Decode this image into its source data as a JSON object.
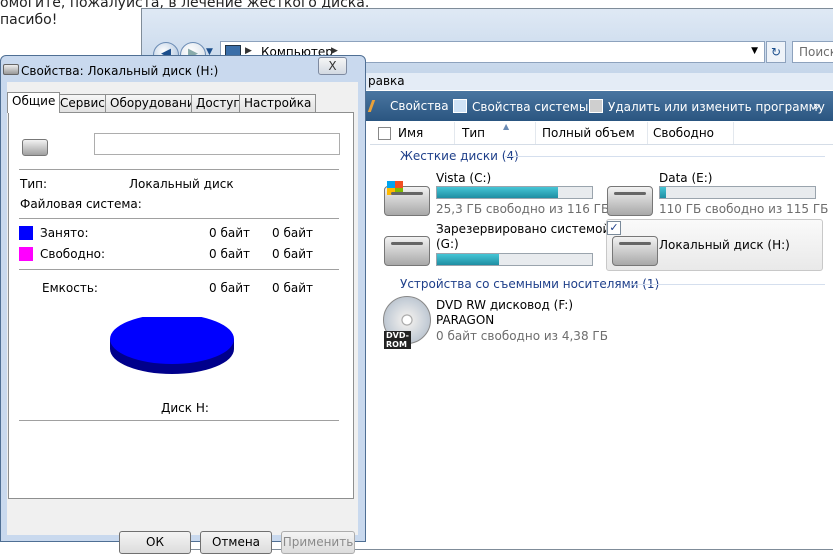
{
  "background": {
    "line1": "омогите, пожалуйста, в лечение жесткого диска.",
    "line2": "пасибо!"
  },
  "explorer": {
    "address": {
      "path": "Компьютер"
    },
    "search_placeholder": "Поиск",
    "menu_fragment": "равка",
    "toolbar": {
      "properties": "Свойства",
      "system_properties": "Свойства системы",
      "uninstall": "Удалить или изменить программу",
      "more": "»"
    },
    "columns": [
      "Имя",
      "Тип",
      "Полный объем",
      "Свободно"
    ],
    "group_hard": "Жесткие диски (4)",
    "group_removable": "Устройства со съемными носителями (1)",
    "drives": [
      {
        "name": "Vista (C:)",
        "free_text": "25,3 ГБ свободно из 116 ГБ",
        "used_fraction": 0.78,
        "icon": "windows-drive-icon"
      },
      {
        "name": "Data (E:)",
        "free_text": "110 ГБ свободно из 115 ГБ",
        "used_fraction": 0.04,
        "icon": "hard-drive-icon"
      },
      {
        "name": "Зарезервировано системой",
        "name2": "(G:)",
        "used_fraction": 0.4,
        "icon": "hard-drive-icon"
      },
      {
        "name": "Локальный диск (H:)",
        "selected": true,
        "icon": "hard-drive-icon"
      }
    ],
    "dvd": {
      "name": "DVD RW дисковод (F:)",
      "label": "PARAGON",
      "free_text": "0 байт свободно из 4,38 ГБ",
      "badge": "DVD-ROM"
    },
    "accent": "#1e3f8a",
    "toolbar_color": "#2a5580"
  },
  "dialog": {
    "title": "Свойства: Локальный диск (H:)",
    "close": "X",
    "tabs": [
      "Общие",
      "Сервис",
      "Оборудование",
      "Доступ",
      "Настройка"
    ],
    "name_value": "",
    "type_label": "Тип:",
    "type_value": "Локальный диск",
    "fs_label": "Файловая система:",
    "used_label": "Занято:",
    "used_bytes": "0 байт",
    "used_gb": "0 байт",
    "free_label": "Свободно:",
    "free_bytes": "0 байт",
    "free_gb": "0 байт",
    "capacity_label": "Емкость:",
    "capacity_bytes": "0 байт",
    "capacity_gb": "0 байт",
    "disk_label": "Диск H:",
    "used_color": "#0000ff",
    "free_color": "#ff00ff",
    "buttons": {
      "ok": "ОК",
      "cancel": "Отмена",
      "apply": "Применить"
    }
  }
}
